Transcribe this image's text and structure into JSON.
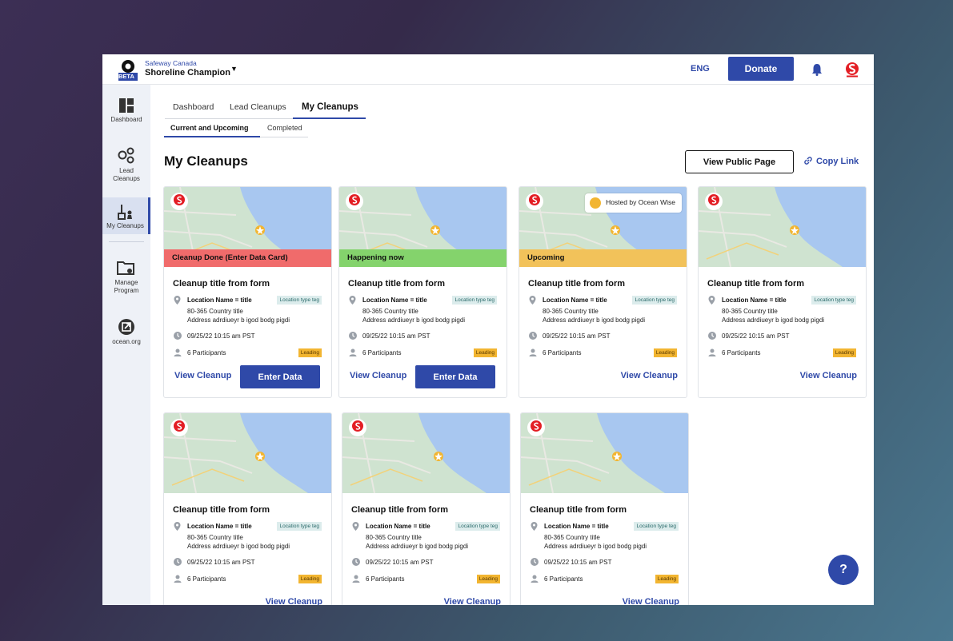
{
  "header": {
    "org": "Safeway Canada",
    "program": "Shoreline Champion",
    "lang": "ENG",
    "donate": "Donate",
    "logo_badge": "BETA"
  },
  "sidebar": {
    "items": [
      {
        "label": "Dashboard",
        "icon": "dashboard-icon"
      },
      {
        "label": "Lead Cleanups",
        "icon": "lead-cleanups-icon"
      },
      {
        "label": "My Cleanups",
        "icon": "my-cleanups-icon"
      },
      {
        "label": "Manage Program",
        "icon": "manage-program-icon"
      },
      {
        "label": "ocean.org",
        "icon": "external-link-icon"
      }
    ]
  },
  "tabs": [
    "Dashboard",
    "Lead Cleanups",
    "My Cleanups"
  ],
  "subtabs": [
    "Current and Upcoming",
    "Completed"
  ],
  "page": {
    "title": "My Cleanups",
    "view_public": "View Public Page",
    "copy_link": "Copy Link"
  },
  "cards": [
    {
      "status": "Cleanup Done (Enter Data Card)",
      "status_color": "#f06b6b",
      "hosted": "",
      "title": "Cleanup title from form",
      "loc_name": "Location Name = title",
      "loc_tag": "Location type teg",
      "addr1": "80-365  Country title",
      "addr2": "Address adrdiueyr b igod bodg pigdi",
      "date": "09/25/22  10:15 am PST",
      "participants": "6 Participants",
      "badge": "Leading",
      "view": "View Cleanup",
      "enter": "Enter Data"
    },
    {
      "status": "Happening now",
      "status_color": "#84d36c",
      "hosted": "",
      "title": "Cleanup title from form",
      "loc_name": "Location Name = title",
      "loc_tag": "Location type teg",
      "addr1": "80-365  Country title",
      "addr2": "Address adrdiueyr b igod bodg pigdi",
      "date": "09/25/22  10:15 am PST",
      "participants": "6 Participants",
      "badge": "Leading",
      "view": "View Cleanup",
      "enter": "Enter Data"
    },
    {
      "status": "Upcoming",
      "status_color": "#f2c25a",
      "hosted": "Hosted by Ocean Wise",
      "title": "Cleanup title from form",
      "loc_name": "Location Name = title",
      "loc_tag": "Location type teg",
      "addr1": "80-365  Country title",
      "addr2": "Address adrdiueyr b igod bodg pigdi",
      "date": "09/25/22  10:15 am PST",
      "participants": "6 Participants",
      "badge": "Leading",
      "view": "View Cleanup",
      "enter": ""
    },
    {
      "status": "",
      "status_color": "",
      "hosted": "",
      "title": "Cleanup title from form",
      "loc_name": "Location Name = title",
      "loc_tag": "Location type teg",
      "addr1": "80-365  Country title",
      "addr2": "Address adrdiueyr b igod bodg pigdi",
      "date": "09/25/22  10:15 am PST",
      "participants": "6 Participants",
      "badge": "Leading",
      "view": "View Cleanup",
      "enter": ""
    },
    {
      "status": "",
      "status_color": "",
      "hosted": "",
      "title": "Cleanup title from form",
      "loc_name": "Location Name = title",
      "loc_tag": "Location type teg",
      "addr1": "80-365  Country title",
      "addr2": "Address adrdiueyr b igod bodg pigdi",
      "date": "09/25/22  10:15 am PST",
      "participants": "6 Participants",
      "badge": "Leading",
      "view": "View Cleanup",
      "enter": ""
    },
    {
      "status": "",
      "status_color": "",
      "hosted": "",
      "title": "Cleanup title from form",
      "loc_name": "Location Name = title",
      "loc_tag": "Location type teg",
      "addr1": "80-365  Country title",
      "addr2": "Address adrdiueyr b igod bodg pigdi",
      "date": "09/25/22  10:15 am PST",
      "participants": "6 Participants",
      "badge": "Leading",
      "view": "View Cleanup",
      "enter": ""
    },
    {
      "status": "",
      "status_color": "",
      "hosted": "",
      "title": "Cleanup title from form",
      "loc_name": "Location Name = title",
      "loc_tag": "Location type teg",
      "addr1": "80-365  Country title",
      "addr2": "Address adrdiueyr b igod bodg pigdi",
      "date": "09/25/22  10:15 am PST",
      "participants": "6 Participants",
      "badge": "Leading",
      "view": "View Cleanup",
      "enter": ""
    }
  ],
  "help": "?",
  "colors": {
    "accent": "#2f49a8",
    "sidebar_bg": "#eef1f7",
    "badge": "#f2b531"
  }
}
